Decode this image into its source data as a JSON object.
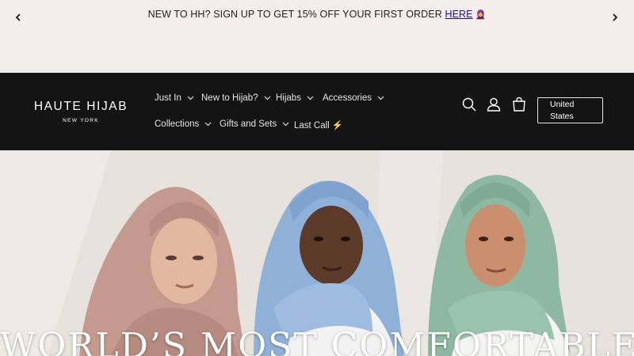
{
  "announcement": {
    "text": "NEW TO HH? SIGN UP TO GET 15% OFF YOUR FIRST ORDER ",
    "link_label": "HERE",
    "emoji": "🧕"
  },
  "header": {
    "logo_main": "HAUTE HIJAB",
    "logo_sub": "NEW YORK",
    "nav": [
      {
        "label": "Just In"
      },
      {
        "label": "New to Hijab?"
      },
      {
        "label": "Hijabs"
      },
      {
        "label": "Accessories"
      },
      {
        "label": "Collections"
      },
      {
        "label": "Gifts and Sets"
      },
      {
        "label": "Last Call ⚡"
      }
    ],
    "icons": [
      "search-icon",
      "account-icon",
      "cart-icon"
    ],
    "country_line1": "United",
    "country_line2": "States"
  },
  "hero": {
    "headline": "WORLD’S MOST COMFORTABLE HIJAB",
    "colors": {
      "left_hijab": "#c49a8e",
      "center_hijab": "#8fb1d8",
      "right_hijab": "#8fb8a2"
    }
  }
}
